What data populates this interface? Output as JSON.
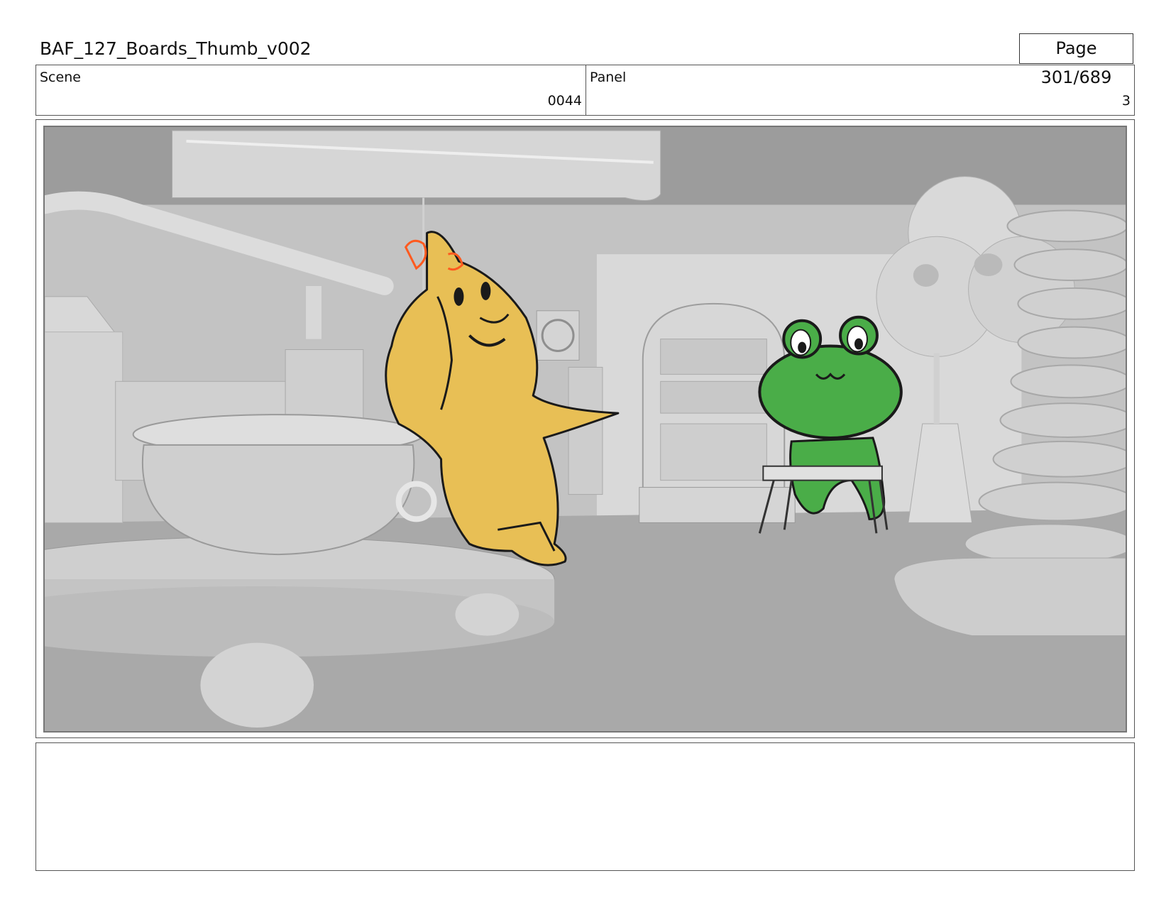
{
  "header": {
    "document_title": "BAF_127_Boards_Thumb_v002",
    "page_label": "Page 301/689"
  },
  "info": {
    "scene_label": "Scene",
    "scene_value": "0044",
    "panel_label": "Panel",
    "panel_value": "3"
  },
  "frame": {
    "image_name": "storyboard-panel-image",
    "characters": [
      "yellow-duck-character",
      "green-frog-character"
    ],
    "colors": {
      "background_set": "#c6c6c6",
      "duck_fill": "#e8bf55",
      "frog_fill": "#4aad48",
      "duck_accent": "#ff5a1f",
      "ink": "#1a1a1a"
    }
  },
  "notes": {
    "text": ""
  }
}
